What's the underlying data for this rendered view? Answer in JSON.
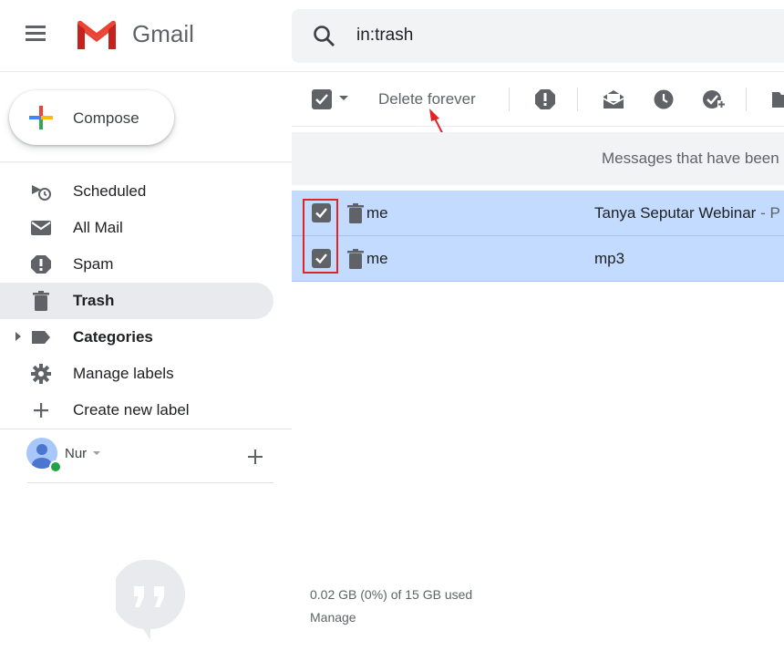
{
  "header": {
    "app_name": "Gmail",
    "search_value": "in:trash"
  },
  "compose": {
    "label": "Compose"
  },
  "sidebar": {
    "items": [
      {
        "label": "Scheduled",
        "icon": "scheduled-icon",
        "active": false,
        "bold": false
      },
      {
        "label": "All Mail",
        "icon": "all-mail-icon",
        "active": false,
        "bold": false
      },
      {
        "label": "Spam",
        "icon": "spam-icon",
        "active": false,
        "bold": false
      },
      {
        "label": "Trash",
        "icon": "trash-icon",
        "active": true,
        "bold": true
      },
      {
        "label": "Categories",
        "icon": "label-icon",
        "active": false,
        "bold": true
      },
      {
        "label": "Manage labels",
        "icon": "gear-icon",
        "active": false,
        "bold": false
      },
      {
        "label": "Create new label",
        "icon": "plus-icon",
        "active": false,
        "bold": false
      }
    ],
    "user": {
      "name": "Nur",
      "status_color": "#1ea446"
    }
  },
  "toolbar": {
    "delete_forever_label": "Delete forever",
    "icons": [
      "report-spam-icon",
      "mark-read-icon",
      "snooze-icon",
      "add-to-tasks-icon",
      "move-to-icon"
    ]
  },
  "banner": {
    "text": "Messages that have been"
  },
  "messages": [
    {
      "sender": "me",
      "subject": "Tanya Seputar Webinar",
      "snippet": " - P",
      "selected": true
    },
    {
      "sender": "me",
      "subject": "mp3",
      "snippet": "",
      "selected": true
    }
  ],
  "footer": {
    "storage_text": "0.02 GB (0%) of 15 GB used",
    "manage_label": "Manage"
  },
  "colors": {
    "selected_row": "#c2dbff",
    "annotation": "#e02424"
  }
}
